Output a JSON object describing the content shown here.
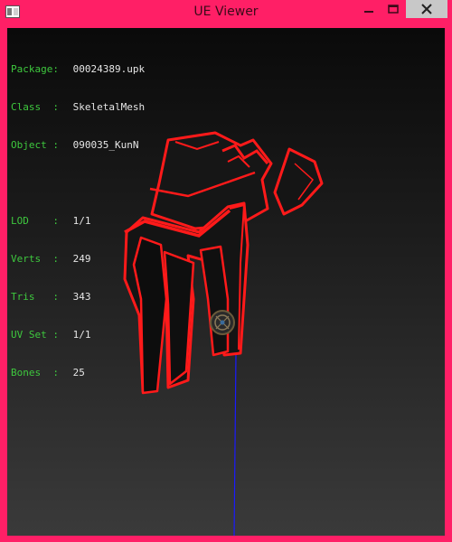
{
  "window": {
    "title": "UE Viewer",
    "icons": {
      "app": "app-icon",
      "minimize": "minimize-icon",
      "maximize": "maximize-icon",
      "close": "close-icon"
    },
    "colors": {
      "frame": "#ff1f66",
      "info_key": "#3ec83e",
      "info_value": "#e6e6e6",
      "mesh_outline": "#ff1a1a",
      "mesh_fill": "#121212",
      "axis": "#1a1aff"
    }
  },
  "info": {
    "package": {
      "label": "Package:",
      "value": "00024389.upk"
    },
    "class": {
      "label": "Class  :",
      "value": "SkeletalMesh"
    },
    "object": {
      "label": "Object :",
      "value": "090035_KunN"
    },
    "lod": {
      "label": "LOD    :",
      "value": "1/1"
    },
    "verts": {
      "label": "Verts  :",
      "value": "249"
    },
    "tris": {
      "label": "Tris   :",
      "value": "343"
    },
    "uvset": {
      "label": "UV Set :",
      "value": "1/1"
    },
    "bones": {
      "label": "Bones  :",
      "value": "25"
    }
  }
}
